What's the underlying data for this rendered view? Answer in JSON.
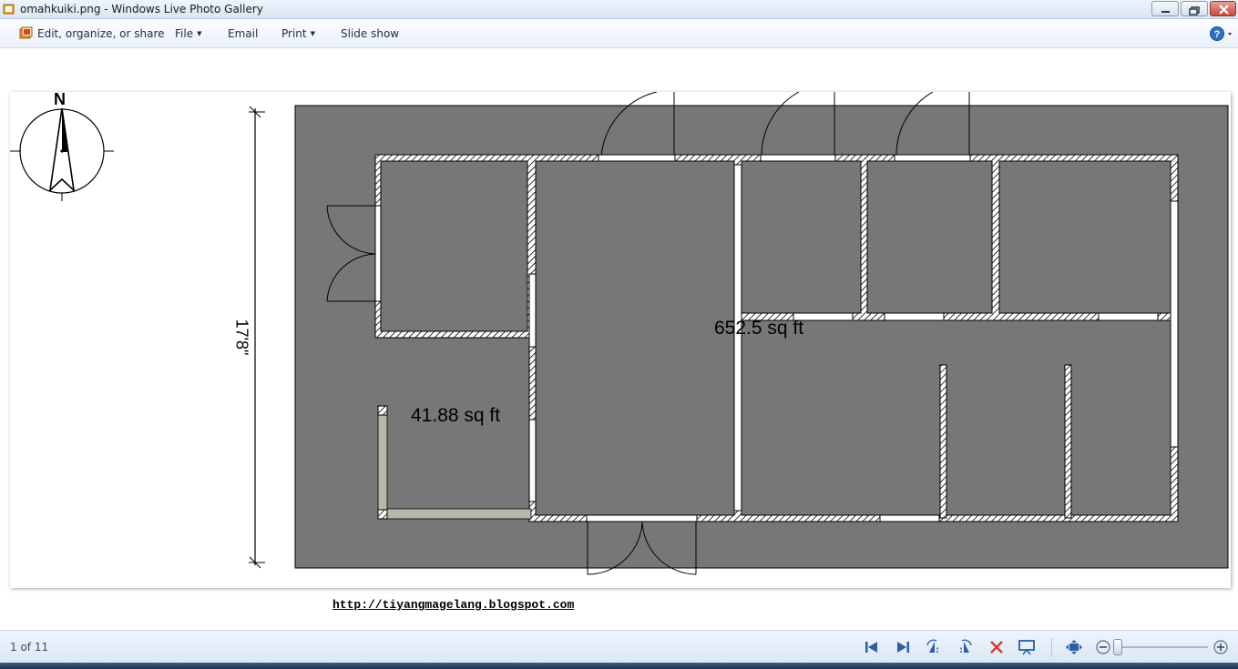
{
  "window": {
    "title": "omahkuiki.png - Windows Live Photo Gallery"
  },
  "menu": {
    "organize_label": "Edit, organize, or share",
    "file_label": "File",
    "email_label": "Email",
    "print_label": "Print",
    "slideshow_label": "Slide show"
  },
  "image": {
    "compass_label": "N",
    "dimension_label": "17'8\"",
    "area_main": "652.5 sq ft",
    "area_small": "41.88 sq ft",
    "link": "http://tiyangmagelang.blogspot.com",
    "colors": {
      "floor": "#777777",
      "wall": "#ffffff",
      "terrace": "#b8b8aa"
    }
  },
  "status": {
    "page_counter": "1 of 11"
  },
  "icons": [
    "app-icon",
    "organize-icon",
    "help-icon",
    "previous-icon",
    "next-icon",
    "rotate-left-icon",
    "rotate-right-icon",
    "delete-icon",
    "slideshow-icon",
    "actual-size-icon",
    "zoom-out-icon",
    "zoom-in-icon"
  ]
}
